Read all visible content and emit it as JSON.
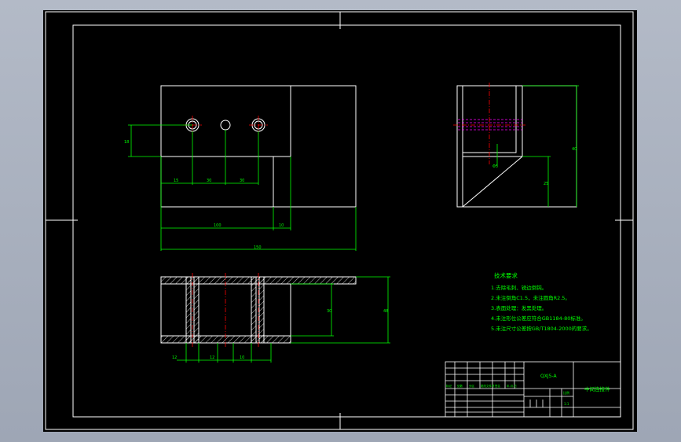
{
  "drawing": {
    "tech_title": "技术要求",
    "tech_notes": [
      "1.去除毛刺、锐边倒钝。",
      "2.未注倒角C1.5，未注圆角R2.5。",
      "3.表面处理：发黑处理。",
      "4.未注形位公差应符合GB1184-80标准。",
      "5.未注尺寸公差按GB/T1804-2000的要求。"
    ],
    "title_block": {
      "code": "QXJ5-A",
      "part_name": "中间连接件",
      "scale_label": "比例",
      "scale_value": "1:1",
      "tiny_labels": [
        "标记",
        "处数",
        "分区",
        "更改文件号",
        "签名",
        "年.月.日"
      ]
    },
    "dims": {
      "front_height": "18",
      "front_spacing_1": "15",
      "front_spacing_2": "30",
      "front_spacing_3": "30",
      "front_inner_width": "100",
      "front_offset": "10",
      "front_total_width": "150",
      "side_height": "40",
      "side_lower_height": "25",
      "side_hole": "Φ5",
      "plan_height": "30",
      "plan_total_height": "48",
      "plan_spacing_1": "12",
      "plan_spacing_2": "12",
      "plan_spacing_3": "10"
    },
    "colors": {
      "outline": "#ffffff",
      "dimension": "#00ff00",
      "centerline": "#ff0000",
      "hidden": "#ff00ff"
    }
  }
}
